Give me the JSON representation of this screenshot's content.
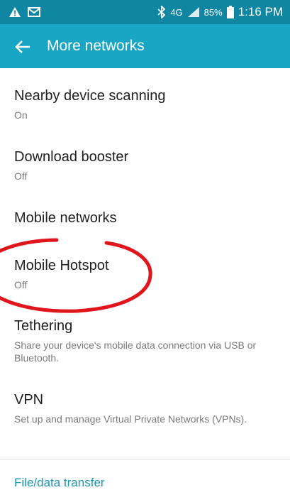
{
  "status_bar": {
    "battery_percent": "85%",
    "time": "1:16 PM",
    "network": "4G"
  },
  "app_bar": {
    "title": "More networks"
  },
  "items": [
    {
      "title": "Nearby device scanning",
      "subtitle": "On"
    },
    {
      "title": "Download booster",
      "subtitle": "Off"
    },
    {
      "title": "Mobile networks",
      "subtitle": ""
    },
    {
      "title": "Mobile Hotspot",
      "subtitle": "Off"
    },
    {
      "title": "Tethering",
      "subtitle": "Share your device's mobile data connection via USB or Bluetooth."
    },
    {
      "title": "VPN",
      "subtitle": "Set up and manage Virtual Private Networks (VPNs)."
    }
  ],
  "section_header": "File/data transfer",
  "colors": {
    "status_bar": "#0f87a2",
    "app_bar": "#19a6c4",
    "accent": "#1b97b5",
    "annotation": "#e1151c"
  }
}
